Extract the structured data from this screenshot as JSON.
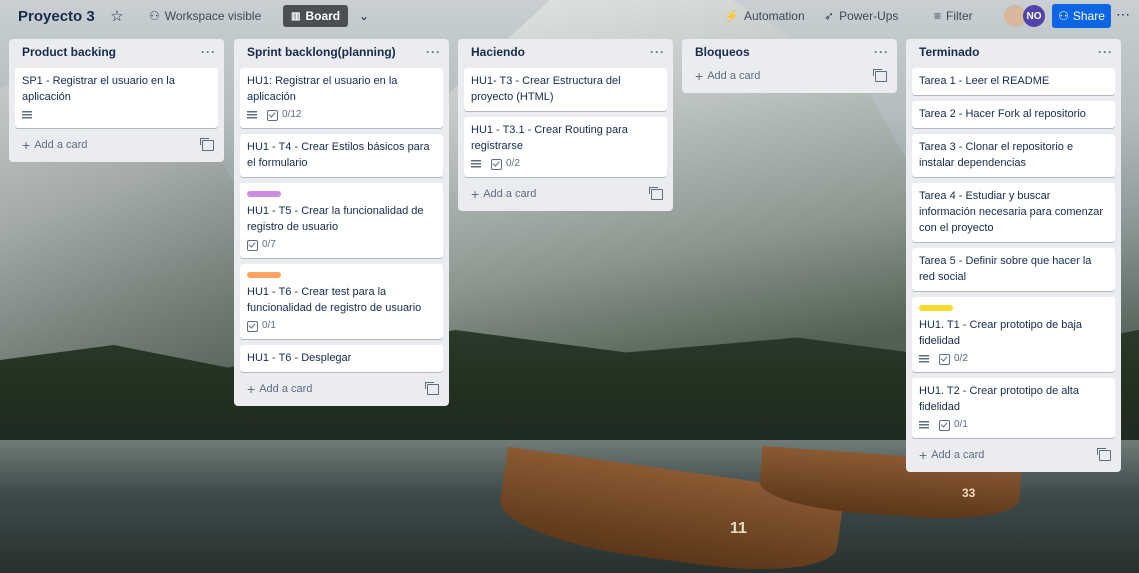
{
  "header": {
    "board_title": "Proyecto 3",
    "visibility_label": "Workspace visible",
    "view_label": "Board",
    "automation_label": "Automation",
    "powerups_label": "Power-Ups",
    "filter_label": "Filter",
    "avatar_initials": "NO",
    "share_label": "Share"
  },
  "lists": [
    {
      "title": "Product backing",
      "cards": [
        {
          "title": "SP1 - Registrar el usuario en la aplicación",
          "has_description": true
        }
      ],
      "add_label": "Add a card"
    },
    {
      "title": "Sprint backlong(planning)",
      "cards": [
        {
          "title": "HU1: Registrar el usuario en la aplicación",
          "has_description": true,
          "checklist": "0/12"
        },
        {
          "title": "HU1 - T4 - Crear Estilos básicos para el formulario"
        },
        {
          "title": "HU1 - T5 - Crear la funcionalidad de registro de usuario",
          "label_color": "#cd8de5",
          "checklist": "0/7"
        },
        {
          "title": "HU1 - T6 - Crear test para la funcionalidad de registro de usuario",
          "label_color": "#fea362",
          "checklist": "0/1"
        },
        {
          "title": "HU1 - T6 - Desplegar"
        }
      ],
      "add_label": "Add a card"
    },
    {
      "title": "Haciendo",
      "cards": [
        {
          "title": "HU1- T3 - Crear Estructura del proyecto (HTML)"
        },
        {
          "title": "HU1 - T3.1 - Crear Routing para registrarse",
          "has_description": true,
          "checklist": "0/2"
        }
      ],
      "add_label": "Add a card"
    },
    {
      "title": "Bloqueos",
      "cards": [],
      "add_label": "Add a card"
    },
    {
      "title": "Terminado",
      "cards": [
        {
          "title": "Tarea 1 - Leer el README"
        },
        {
          "title": "Tarea 2 - Hacer Fork al repositorio"
        },
        {
          "title": "Tarea 3 - Clonar el repositorio e instalar dependencias"
        },
        {
          "title": "Tarea 4 - Estudiar y buscar información necesaria para comenzar con el proyecto"
        },
        {
          "title": "Tarea 5 - Definir sobre que hacer la red social"
        },
        {
          "title": "HU1. T1 - Crear prototipo de baja fidelidad",
          "label_color": "#f5dd29",
          "has_description": true,
          "checklist": "0/2"
        },
        {
          "title": "HU1. T2 - Crear prototipo de alta fidelidad",
          "has_description": true,
          "checklist": "0/1"
        }
      ],
      "add_label": "Add a card"
    }
  ],
  "colors": {
    "share_button": "#0c66e4",
    "list_background": "#ebecf0",
    "avatar": "#5243aa"
  }
}
